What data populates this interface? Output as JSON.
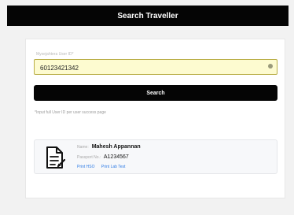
{
  "header": {
    "title": "Search Traveller"
  },
  "search": {
    "label": "Mysejahtera User ID*",
    "value": "60123421342",
    "button_label": "Search",
    "hint": "*Input full User ID per user success page"
  },
  "result": {
    "name_label": "Name:",
    "name": "Mahesh Appannan",
    "passport_label": "Passport No.:",
    "passport": "A1234567",
    "links": {
      "print_hso": "Print HSO",
      "print_lab_test": "Print Lab Test"
    }
  },
  "icons": {
    "document": "document-icon",
    "clear": "clear-icon"
  },
  "colors": {
    "header_bg": "#050505",
    "input_bg": "#fdfbd0",
    "input_border": "#b8ad45",
    "link": "#2e7be5"
  }
}
